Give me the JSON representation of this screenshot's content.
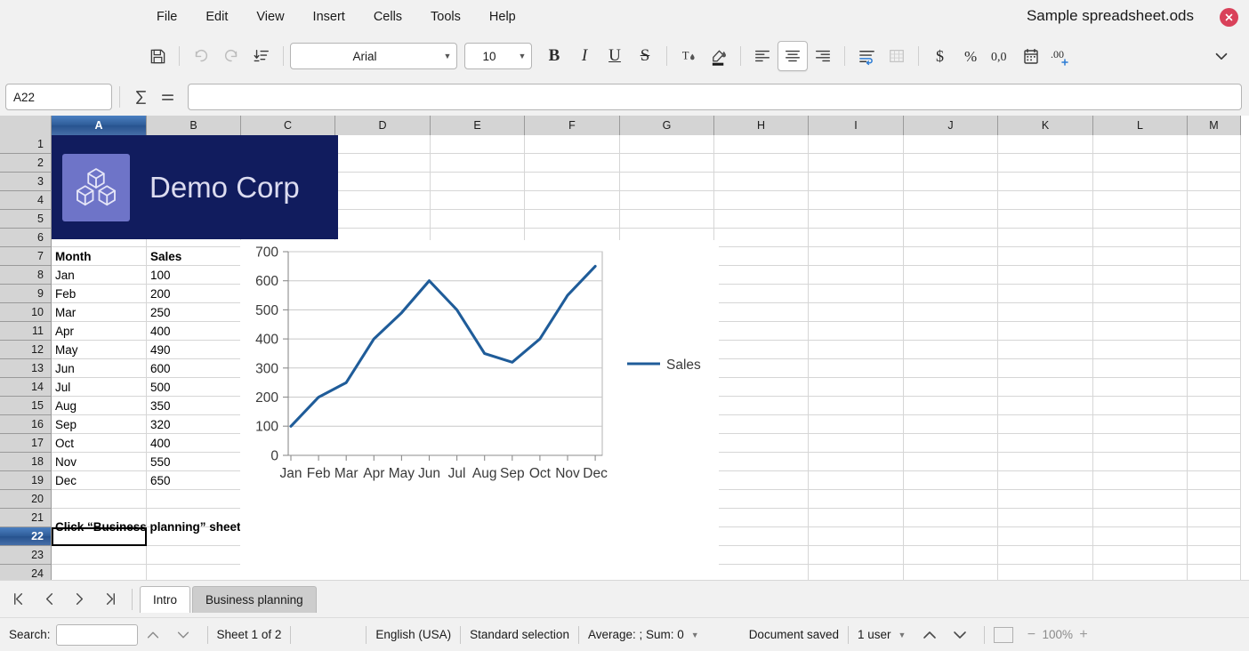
{
  "window": {
    "title": "Sample spreadsheet.ods",
    "close_icon": "close-icon"
  },
  "menubar": {
    "items": [
      {
        "label": "File"
      },
      {
        "label": "Edit"
      },
      {
        "label": "View"
      },
      {
        "label": "Insert"
      },
      {
        "label": "Cells"
      },
      {
        "label": "Tools"
      },
      {
        "label": "Help"
      }
    ]
  },
  "toolbar": {
    "save_icon": "save-icon",
    "undo_icon": "undo-icon",
    "redo_icon": "redo-icon",
    "sort_icon": "sort-ascending-icon",
    "font_name": "Arial",
    "font_size": "10",
    "bold_label": "B",
    "italic_label": "I",
    "underline_label": "U",
    "strikethrough_label": "S",
    "font_color_icon": "font-color-icon",
    "highlight_icon": "highlight-color-icon",
    "align_left_icon": "align-left-icon",
    "align_center_icon": "align-center-icon",
    "align_right_icon": "align-right-icon",
    "wrap_text_icon": "wrap-text-icon",
    "borders_icon": "borders-icon",
    "currency_icon": "currency-format-icon",
    "percent_icon": "percent-format-icon",
    "number_icon": "number-format-icon",
    "date_icon": "date-format-icon",
    "add_decimal_icon": "add-decimal-icon",
    "overflow_icon": "chevron-down-icon"
  },
  "formulabar": {
    "name_box_value": "A22",
    "sum_icon": "sum-icon",
    "formula_icon": "equals-icon",
    "formula_value": "",
    "formula_placeholder": ""
  },
  "grid": {
    "columns": [
      "A",
      "B",
      "C",
      "D",
      "E",
      "F",
      "G",
      "H",
      "I",
      "J",
      "K",
      "L",
      "M"
    ],
    "selected_column": "A",
    "rows": [
      "1",
      "2",
      "3",
      "4",
      "5",
      "6",
      "7",
      "8",
      "9",
      "10",
      "11",
      "12",
      "13",
      "14",
      "15",
      "16",
      "17",
      "18",
      "19",
      "20",
      "21",
      "22",
      "23",
      "24"
    ],
    "selected_row": "22",
    "selected_cell": "A22",
    "banner": {
      "company_name": "Demo Corp",
      "logo_icon": "cubes-logo-icon"
    },
    "table": {
      "headers": [
        "Month",
        "Sales"
      ],
      "rows": [
        {
          "month": "Jan",
          "sales": "100"
        },
        {
          "month": "Feb",
          "sales": "200"
        },
        {
          "month": "Mar",
          "sales": "250"
        },
        {
          "month": "Apr",
          "sales": "400"
        },
        {
          "month": "May",
          "sales": "490"
        },
        {
          "month": "Jun",
          "sales": "600"
        },
        {
          "month": "Jul",
          "sales": "500"
        },
        {
          "month": "Aug",
          "sales": "350"
        },
        {
          "month": "Sep",
          "sales": "320"
        },
        {
          "month": "Oct",
          "sales": "400"
        },
        {
          "month": "Nov",
          "sales": "550"
        },
        {
          "month": "Dec",
          "sales": "650"
        }
      ]
    },
    "note_row21": "Click “Business planning” sheet below to see formulas in action!"
  },
  "chart_data": {
    "type": "line",
    "title": "",
    "xlabel": "",
    "ylabel": "",
    "categories": [
      "Jan",
      "Feb",
      "Mar",
      "Apr",
      "May",
      "Jun",
      "Jul",
      "Aug",
      "Sep",
      "Oct",
      "Nov",
      "Dec"
    ],
    "series": [
      {
        "name": "Sales",
        "values": [
          100,
          200,
          250,
          400,
          490,
          600,
          500,
          350,
          320,
          400,
          550,
          650
        ],
        "color": "#1f5c99"
      }
    ],
    "ylim": [
      0,
      700
    ],
    "yticks": [
      0,
      100,
      200,
      300,
      400,
      500,
      600,
      700
    ],
    "grid": "horizontal",
    "legend_position": "right"
  },
  "sheet_tabs": {
    "first_icon": "first-sheet-icon",
    "prev_icon": "previous-sheet-icon",
    "next_icon": "next-sheet-icon",
    "last_icon": "last-sheet-icon",
    "tabs": [
      {
        "label": "Intro",
        "active": true
      },
      {
        "label": "Business planning",
        "active": false
      }
    ]
  },
  "statusbar": {
    "search_label": "Search:",
    "search_value": "",
    "search_up_icon": "chevron-up-icon",
    "search_down_icon": "chevron-down-icon",
    "sheet_count": "Sheet 1 of 2",
    "language": "English (USA)",
    "selection_mode": "Standard selection",
    "summary": "Average: ; Sum: 0",
    "save_state": "Document saved",
    "users": "1 user",
    "nav_up_icon": "chevron-up-icon",
    "nav_down_icon": "chevron-down-icon",
    "view_layout_icon": "view-layout-icon",
    "zoom_out_label": "−",
    "zoom_level": "100%",
    "zoom_in_label": "+"
  },
  "colors": {
    "banner_bg": "#111c5e",
    "logo_bg": "#6e74c8",
    "chart_line": "#1f5c99",
    "header_sel": "#2f5d99",
    "close_btn": "#d9415a"
  }
}
